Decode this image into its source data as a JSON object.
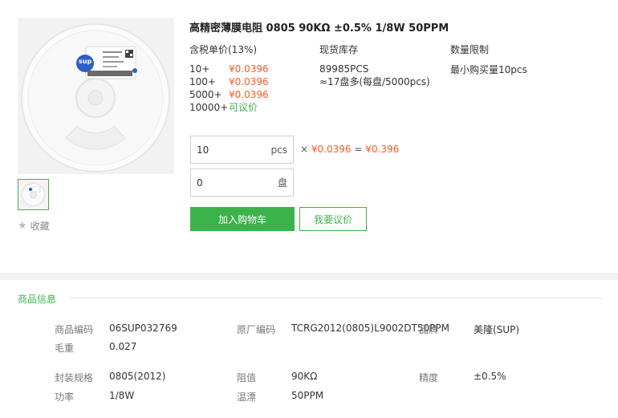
{
  "product": {
    "title": "高精密薄膜电阻 0805 90KΩ ±0.5% 1/8W 50PPM",
    "image_logo": "sup",
    "favorite_label": "收藏"
  },
  "pricing": {
    "header": "含税单价(13%)",
    "tiers": [
      {
        "qty": "10+",
        "price": "¥0.0396"
      },
      {
        "qty": "100+",
        "price": "¥0.0396"
      },
      {
        "qty": "5000+",
        "price": "¥0.0396"
      },
      {
        "qty": "10000+",
        "price": "可议价"
      }
    ]
  },
  "stock": {
    "header": "现货库存",
    "count": "89985PCS",
    "reels": "≈17盘多(每盘/5000pcs)"
  },
  "limit": {
    "header": "数量限制",
    "text": "最小购买量10pcs"
  },
  "order": {
    "qty_value": "10",
    "qty_unit": "pcs",
    "reel_value": "0",
    "reel_unit": "盘",
    "multiply": "×",
    "unit_price": "¥0.0396",
    "equals": "=",
    "total": "¥0.396",
    "add_cart_label": "加入购物车",
    "quote_label": "我要议价"
  },
  "colors": {
    "accent_green": "#3cb34a",
    "price_orange": "#ff5a1f"
  },
  "info": {
    "section_title": "商品信息",
    "rows": [
      [
        {
          "label": "商品编码",
          "value": "06SUP032769"
        },
        {
          "label": "原厂编码",
          "value": "TCRG2012(0805)L9002DT50PPM"
        },
        {
          "label": "品牌",
          "value": "美隆(SUP)"
        }
      ],
      [
        {
          "label": "毛重",
          "value": "0.027"
        }
      ],
      [
        {
          "label": "封装规格",
          "value": "0805(2012)"
        },
        {
          "label": "阻值",
          "value": "90KΩ"
        },
        {
          "label": "精度",
          "value": "±0.5%"
        }
      ],
      [
        {
          "label": "功率",
          "value": "1/8W"
        },
        {
          "label": "温漂",
          "value": "50PPM"
        }
      ]
    ]
  }
}
